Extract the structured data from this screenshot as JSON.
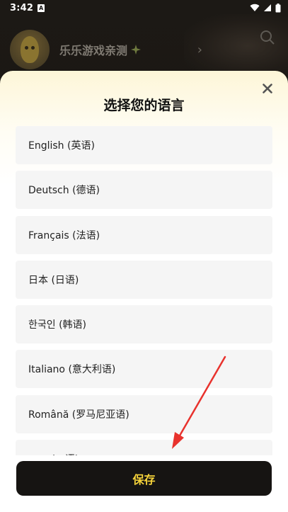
{
  "status_bar": {
    "time": "3:42",
    "notif_letter": "A",
    "icons": [
      "wifi-icon",
      "signal-icon",
      "battery-icon"
    ]
  },
  "background": {
    "profile_name": "乐乐游戏亲测",
    "icons": [
      "avatar-banana",
      "verified-sparkle-icon",
      "chevron-right-icon",
      "search-icon"
    ]
  },
  "sheet": {
    "title": "选择您的语言",
    "languages": [
      "English (英语)",
      "Deutsch (德语)",
      "Français (法语)",
      "日本 (日语)",
      "한국인 (韩语)",
      "Italiano (意大利语)",
      "Română (罗马尼亚语)",
      "…… (…语)"
    ],
    "save_label": "保存"
  },
  "colors": {
    "accent_text": "#f6d33a",
    "button_bg": "#161412",
    "item_bg": "#f5f5f5",
    "annotation_red": "#e8322d"
  }
}
